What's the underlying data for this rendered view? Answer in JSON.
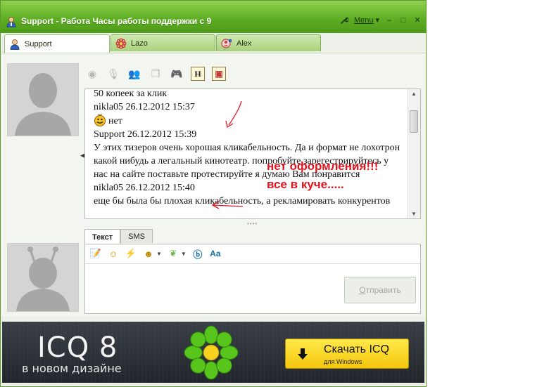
{
  "window": {
    "title": "Support - Работа Часы работы поддержки с 9",
    "menu_label": "Menu",
    "minimize": "–",
    "maximize": "□",
    "close": "✕"
  },
  "tabs": [
    {
      "label": "Support",
      "active": true
    },
    {
      "label": "Lazo",
      "active": false
    },
    {
      "label": "Alex",
      "active": false
    }
  ],
  "chat": {
    "lines": [
      {
        "type": "text",
        "text": "50 копеек за клик"
      },
      {
        "type": "header",
        "text": "nikla05 26.12.2012 15:37"
      },
      {
        "type": "smile",
        "text": "нет"
      },
      {
        "type": "header",
        "text": "Support 26.12.2012 15:39"
      },
      {
        "type": "para",
        "text": "У этих тизеров очень хорошая кликабельность. Да и формат не лохотрон какой нибудь а легальный кинотеатр. попробуйте зарегестрируйтесь у нас на сайте поставьте протестируйте я думаю Вам понравится"
      },
      {
        "type": "header",
        "text": "nikla05 26.12.2012 15:40"
      },
      {
        "type": "text",
        "text": "еще бы была бы плохая кликабельность, а рекламировать конкурентов"
      }
    ]
  },
  "annotation": {
    "line1": "нет оформления!!!",
    "line2": "все в куче....."
  },
  "input": {
    "tab_text": "Текст",
    "tab_sms": "SMS",
    "send_label": "Отправить",
    "send_hotkey": "О",
    "send_rest": "тправить"
  },
  "ad": {
    "title": "ICQ 8",
    "subtitle": "в новом дизайне",
    "button_main": "Скачать ICQ",
    "button_sub": "для Windows"
  },
  "colors": {
    "accent_green": "#5fae24",
    "annotation_red": "#e0141e",
    "ad_button": "#f4c70c"
  }
}
